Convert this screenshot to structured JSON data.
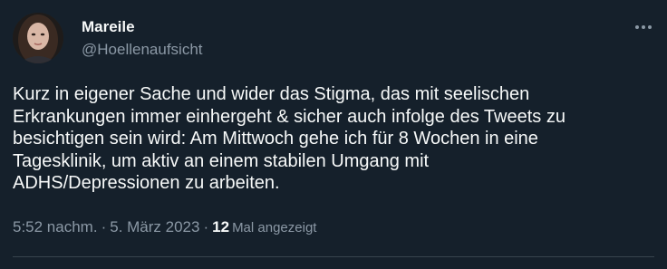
{
  "author": {
    "display_name": "Mareile",
    "handle": "@Hoellenaufsicht"
  },
  "tweet": {
    "text": "Kurz in eigener Sache und wider das Stigma, das mit seelischen\nErkrankungen immer einhergeht & sicher auch infolge des Tweets zu\nbesichtigen sein wird: Am Mittwoch gehe ich für 8 Wochen in eine\nTagesklinik, um aktiv an einem stabilen Umgang mit\nADHS/Depressionen zu arbeiten."
  },
  "meta": {
    "time": "5:52 nachm.",
    "separator": "·",
    "date": "5. März 2023",
    "views_count": "12",
    "views_label": "Mal angezeigt"
  },
  "icons": {
    "more": "more-horizontal-icon"
  },
  "colors": {
    "background": "#15202b",
    "primary_text": "#f7f9f9",
    "secondary_text": "#8b98a5",
    "divider": "#38444d"
  }
}
